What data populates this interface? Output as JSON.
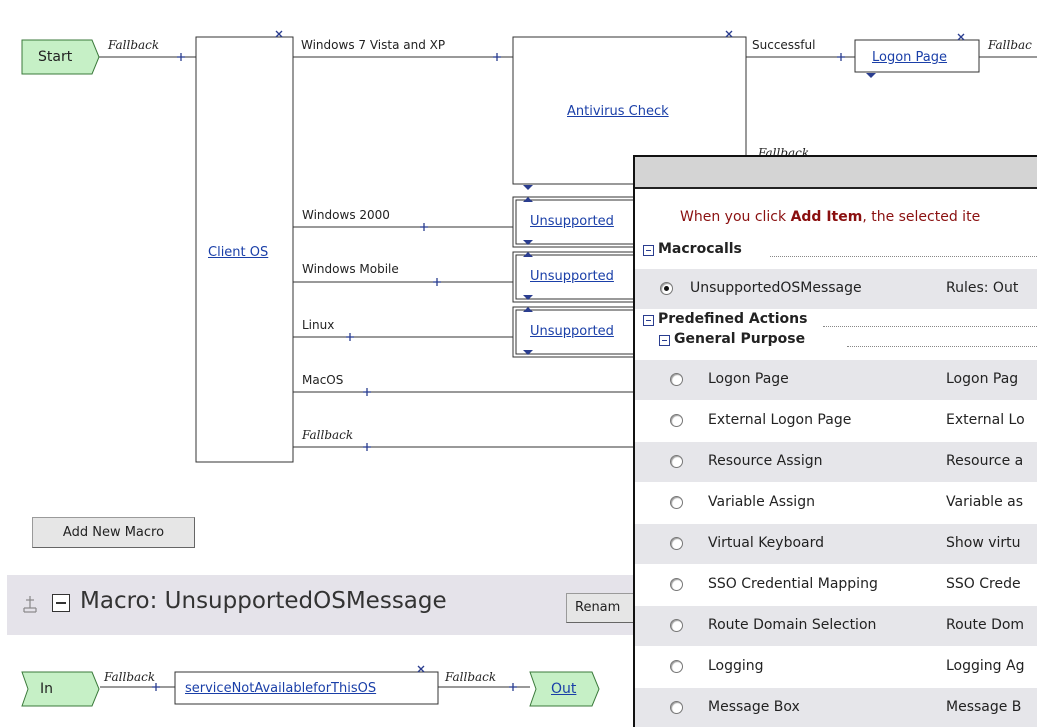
{
  "flow": {
    "start_label": "Start",
    "fallback": "Fallback",
    "client_os": "Client OS",
    "branches": [
      "Windows 7 Vista and XP",
      "Windows 2000",
      "Windows Mobile",
      "Linux",
      "MacOS",
      "Fallback"
    ],
    "antivirus_check": "Antivirus Check",
    "av_successful": "Successful",
    "av_fallback": "Fallback",
    "logon_page": "Logon Page",
    "logon_fallback": "Fallbac",
    "unsupported": [
      "Unsupported",
      "Unsupported",
      "Unsupported"
    ]
  },
  "add_macro_button": "Add New Macro",
  "macro": {
    "title": "Macro: UnsupportedOSMessage",
    "rename_button": "Renam",
    "in_label": "In",
    "fallback1": "Fallback",
    "service_link": "serviceNotAvailableforThisOS",
    "fallback2": "Fallback",
    "out_label": "Out"
  },
  "popup": {
    "instruction_prefix": "When you click ",
    "instruction_bold": "Add Item",
    "instruction_suffix": ", the selected ite",
    "macrocalls_header": "Macrocalls",
    "macrocall_item": {
      "name": "UnsupportedOSMessage",
      "desc": "Rules: Out",
      "selected": true
    },
    "predefined_header": "Predefined Actions",
    "general_header": "General Purpose",
    "items": [
      {
        "name": "Logon Page",
        "desc": "Logon Pag"
      },
      {
        "name": "External Logon Page",
        "desc": "External Lo"
      },
      {
        "name": "Resource Assign",
        "desc": "Resource a"
      },
      {
        "name": "Variable Assign",
        "desc": "Variable as"
      },
      {
        "name": "Virtual Keyboard",
        "desc": "Show virtu"
      },
      {
        "name": "SSO Credential Mapping",
        "desc": "SSO Crede"
      },
      {
        "name": "Route Domain Selection",
        "desc": "Route Dom"
      },
      {
        "name": "Logging",
        "desc": "Logging Ag"
      },
      {
        "name": "Message Box",
        "desc": "Message B"
      }
    ]
  },
  "colors": {
    "terminal_fill": "#c6f0c6",
    "terminal_border": "#3b7a3b",
    "link": "#1a3fa8",
    "connector": "#2a3d8f"
  }
}
